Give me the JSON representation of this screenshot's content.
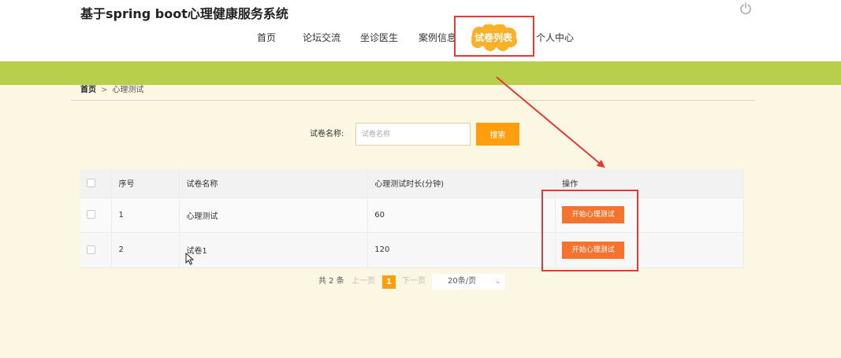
{
  "header": {
    "site_title": "基于spring boot心理健康服务系统",
    "power_icon": "power-icon"
  },
  "nav": {
    "items": [
      {
        "label": "首页"
      },
      {
        "label": "论坛交流"
      },
      {
        "label": "坐诊医生"
      },
      {
        "label": "案例信息"
      },
      {
        "label": "试卷列表",
        "active": true
      },
      {
        "label": "个人中心"
      }
    ]
  },
  "breadcrumb": {
    "home": "首页",
    "separator": ">",
    "current": "心理测试"
  },
  "search": {
    "label": "试卷名称:",
    "placeholder": "试卷名称",
    "value": "",
    "button": "搜索"
  },
  "table": {
    "headers": [
      "",
      "序号",
      "试卷名称",
      "心理测试时长(分钟)",
      "操作"
    ],
    "rows": [
      {
        "index": "1",
        "name": "心理测试",
        "duration": "60",
        "action": "开始心理测试"
      },
      {
        "index": "2",
        "name": "试卷1",
        "duration": "120",
        "action": "开始心理测试"
      }
    ]
  },
  "pagination": {
    "total": "共 2 条",
    "prev": "上一页",
    "current": "1",
    "next": "下一页",
    "page_size": "20条/页"
  },
  "colors": {
    "accent": "#ff9f0d",
    "green_band": "#b7cf4b",
    "action_button": "#f5732d",
    "annotation": "#e53935"
  }
}
